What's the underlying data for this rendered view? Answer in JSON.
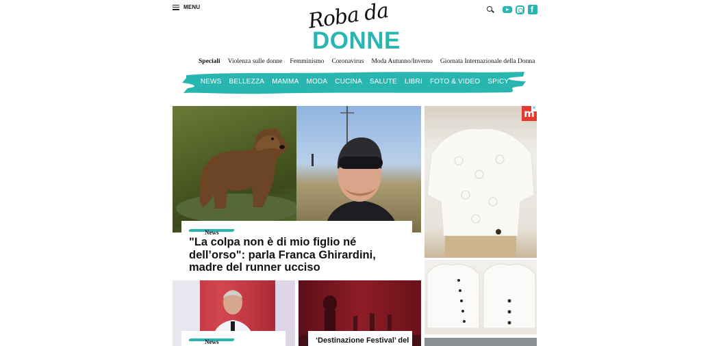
{
  "header": {
    "menu_label": "MENU",
    "logo_script": "Roba da",
    "logo_main": "DONNE",
    "social": [
      "youtube-icon",
      "instagram-icon",
      "facebook-icon"
    ],
    "accent_color": "#2ab6b0"
  },
  "speciali": [
    "Speciali",
    "Violenza sulle donne",
    "Femminismo",
    "Coronavirus",
    "Moda Autunno/Inverno",
    "Giornata Internazionale della Donna"
  ],
  "nav": [
    "NEWS",
    "BELLEZZA",
    "MAMMA",
    "MODA",
    "CUCINA",
    "SALUTE",
    "LIBRI",
    "FOTO & VIDEO",
    "SPICY"
  ],
  "main_article": {
    "category": "News",
    "headline": "\"La colpa non è di mio figlio né dell’orso\": parla Franca Ghirardini, madre del runner ucciso"
  },
  "secondary_articles": [
    {
      "category": "News",
      "headline": ""
    },
    {
      "category": "",
      "headline": "‘Destinazione Festival’ del"
    }
  ],
  "ad": {
    "badge": "m"
  }
}
